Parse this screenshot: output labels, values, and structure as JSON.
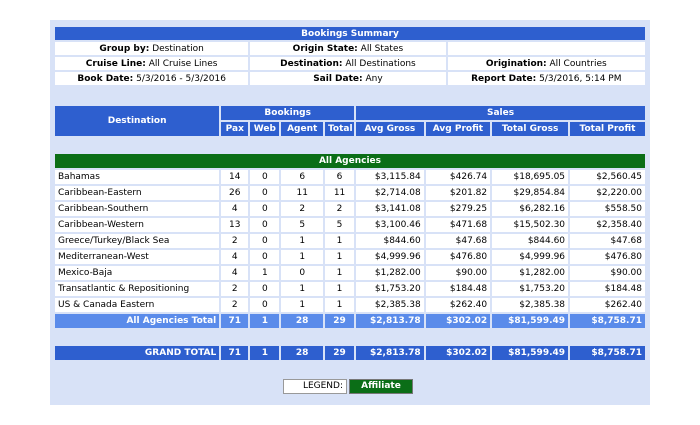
{
  "summary": {
    "title": "Bookings Summary",
    "group_by_label": "Group by:",
    "group_by_value": "Destination",
    "origin_state_label": "Origin State:",
    "origin_state_value": "All States",
    "cruise_line_label": "Cruise Line:",
    "cruise_line_value": "All Cruise Lines",
    "destination_label": "Destination:",
    "destination_value": "All Destinations",
    "origination_label": "Origination:",
    "origination_value": "All Countries",
    "book_date_label": "Book Date:",
    "book_date_value": "5/3/2016 - 5/3/2016",
    "sail_date_label": "Sail Date:",
    "sail_date_value": "Any",
    "report_date_label": "Report Date:",
    "report_date_value": "5/3/2016, 5:14 PM"
  },
  "table": {
    "headers": {
      "destination": "Destination",
      "bookings": "Bookings",
      "sales": "Sales",
      "pax": "Pax",
      "web": "Web",
      "agent": "Agent",
      "total": "Total",
      "avg_gross": "Avg Gross",
      "avg_profit": "Avg Profit",
      "total_gross": "Total Gross",
      "total_profit": "Total Profit"
    },
    "group_label": "All Agencies",
    "rows": [
      [
        "Bahamas",
        "14",
        "0",
        "6",
        "6",
        "$3,115.84",
        "$426.74",
        "$18,695.05",
        "$2,560.45"
      ],
      [
        "Caribbean-Eastern",
        "26",
        "0",
        "11",
        "11",
        "$2,714.08",
        "$201.82",
        "$29,854.84",
        "$2,220.00"
      ],
      [
        "Caribbean-Southern",
        "4",
        "0",
        "2",
        "2",
        "$3,141.08",
        "$279.25",
        "$6,282.16",
        "$558.50"
      ],
      [
        "Caribbean-Western",
        "13",
        "0",
        "5",
        "5",
        "$3,100.46",
        "$471.68",
        "$15,502.30",
        "$2,358.40"
      ],
      [
        "Greece/Turkey/Black Sea",
        "2",
        "0",
        "1",
        "1",
        "$844.60",
        "$47.68",
        "$844.60",
        "$47.68"
      ],
      [
        "Mediterranean-West",
        "4",
        "0",
        "1",
        "1",
        "$4,999.96",
        "$476.80",
        "$4,999.96",
        "$476.80"
      ],
      [
        "Mexico-Baja",
        "4",
        "1",
        "0",
        "1",
        "$1,282.00",
        "$90.00",
        "$1,282.00",
        "$90.00"
      ],
      [
        "Transatlantic & Repositioning",
        "2",
        "0",
        "1",
        "1",
        "$1,753.20",
        "$184.48",
        "$1,753.20",
        "$184.48"
      ],
      [
        "US & Canada Eastern",
        "2",
        "0",
        "1",
        "1",
        "$2,385.38",
        "$262.40",
        "$2,385.38",
        "$262.40"
      ]
    ],
    "agencies_total": [
      "All Agencies Total",
      "71",
      "1",
      "28",
      "29",
      "$2,813.78",
      "$302.02",
      "$81,599.49",
      "$8,758.71"
    ],
    "grand_total": [
      "GRAND TOTAL",
      "71",
      "1",
      "28",
      "29",
      "$2,813.78",
      "$302.02",
      "$81,599.49",
      "$8,758.71"
    ]
  },
  "legend": {
    "label": "LEGEND:",
    "affiliate": "Affiliate"
  },
  "colors": {
    "header_blue": "#2e5fcf",
    "group_green": "#0b6e17",
    "total_blue": "#5a8bea",
    "panel": "#d8e2f7"
  }
}
